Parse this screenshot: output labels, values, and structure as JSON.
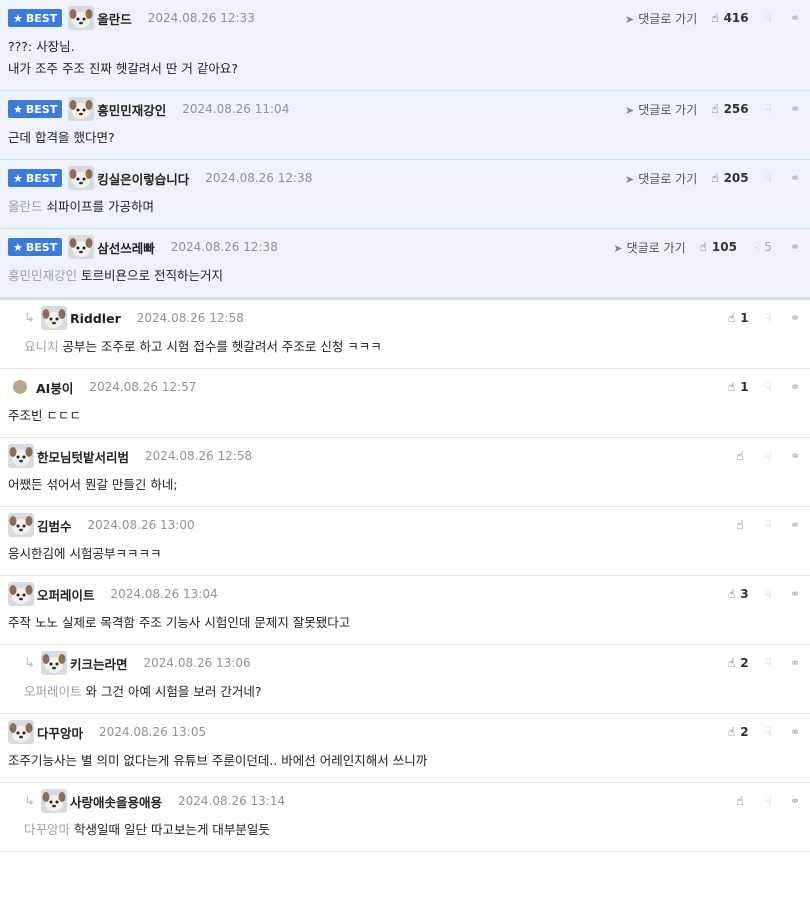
{
  "labels": {
    "best": "BEST",
    "reply_link": "댓글로 가기"
  },
  "colors": {
    "best_bg": "#eef3fb",
    "badge": "#3d7bd8",
    "mention": "#9aa0a8"
  },
  "comments": [
    {
      "best": true,
      "reply": false,
      "avatar": "dog-avatar",
      "nick": "올란드",
      "time": "2024.08.26 12:33",
      "likes": "416",
      "dislikes": "",
      "mention": "",
      "text": "???: 사장님.\n내가 조주 주조 진짜 헷갈려서 딴 거 같아요?"
    },
    {
      "best": true,
      "reply": false,
      "avatar": "dog-avatar",
      "nick": "흥민민재강인",
      "time": "2024.08.26 11:04",
      "likes": "256",
      "dislikes": "",
      "mention": "",
      "text": "근데 합격을 했다면?"
    },
    {
      "best": true,
      "reply": false,
      "avatar": "dog-avatar",
      "nick": "킹실은이렇습니다",
      "time": "2024.08.26 12:38",
      "likes": "205",
      "dislikes": "",
      "mention": "올란드",
      "text": "쇠파이프를 가공하며"
    },
    {
      "best": true,
      "reply": false,
      "avatar": "dog-avatar",
      "nick": "삼선쓰레빠",
      "time": "2024.08.26 12:38",
      "likes": "105",
      "dislikes": "5",
      "mention": "흥민민재강인",
      "text": "토르비욘으로 전직하는거지"
    },
    {
      "best": false,
      "reply": true,
      "avatar": "dog-avatar",
      "nick": "Riddler",
      "time": "2024.08.26 12:58",
      "likes": "1",
      "dislikes": "",
      "mention": "요니치",
      "text": "공부는 조주로 하고 시험 접수를 헷갈려서 주조로 신청 ㅋㅋㅋ"
    },
    {
      "best": false,
      "reply": false,
      "avatar": "dot-avatar",
      "nick": "AI붕이",
      "time": "2024.08.26 12:57",
      "likes": "1",
      "dislikes": "",
      "mention": "",
      "text": "주조빈 ㄷㄷㄷ"
    },
    {
      "best": false,
      "reply": false,
      "avatar": "dog-avatar",
      "nick": "한모님텃밭서리범",
      "time": "2024.08.26 12:58",
      "likes": "",
      "dislikes": "",
      "mention": "",
      "text": "어쨌든 섞어서 뭔갈 만들긴 하네;"
    },
    {
      "best": false,
      "reply": false,
      "avatar": "dog-avatar",
      "nick": "김범수",
      "time": "2024.08.26 13:00",
      "likes": "",
      "dislikes": "",
      "mention": "",
      "text": "응시한김에 시험공부ㅋㅋㅋㅋ"
    },
    {
      "best": false,
      "reply": false,
      "avatar": "dog-avatar",
      "nick": "오퍼레이트",
      "time": "2024.08.26 13:04",
      "likes": "3",
      "dislikes": "",
      "mention": "",
      "text": "주작 노노 실제로 목격함 주조 기능사 시험인데 문제지 잘못됐다고"
    },
    {
      "best": false,
      "reply": true,
      "avatar": "dog-avatar",
      "nick": "키크는라면",
      "time": "2024.08.26 13:06",
      "likes": "2",
      "dislikes": "",
      "mention": "오퍼레이트",
      "text": "와 그건 아예 시험을 보러 간거네?"
    },
    {
      "best": false,
      "reply": false,
      "avatar": "dog-avatar",
      "nick": "다꾸앙마",
      "time": "2024.08.26 13:05",
      "likes": "2",
      "dislikes": "",
      "mention": "",
      "text": "조주기능사는 별 의미 없다는게 유튜브 주룬이던데.. 바에선 어레인지해서 쓰니까"
    },
    {
      "best": false,
      "reply": true,
      "avatar": "dog-avatar",
      "nick": "사랑애솟을용애용",
      "time": "2024.08.26 13:14",
      "likes": "",
      "dislikes": "",
      "mention": "다꾸앙마",
      "text": "학생일때 일단 따고보는게 대부분일듯"
    }
  ]
}
